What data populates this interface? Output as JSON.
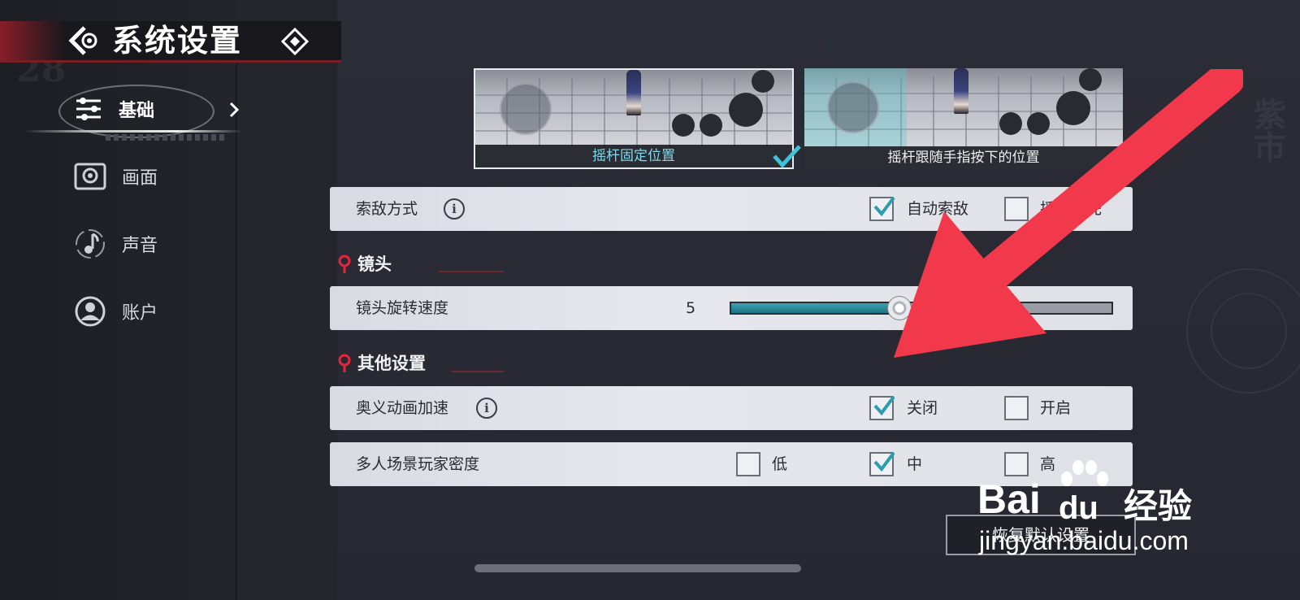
{
  "header": {
    "title": "系统设置"
  },
  "sidebar": {
    "items": [
      {
        "label": "基础",
        "icon": "sliders-icon",
        "active": true
      },
      {
        "label": "画面",
        "icon": "display-icon",
        "active": false
      },
      {
        "label": "声音",
        "icon": "music-note-icon",
        "active": false
      },
      {
        "label": "账户",
        "icon": "user-icon",
        "active": false
      }
    ]
  },
  "joystick": {
    "options": [
      {
        "label": "摇杆固定位置",
        "selected": true
      },
      {
        "label": "摇杆跟随手指按下的位置",
        "selected": false
      }
    ]
  },
  "targeting": {
    "label": "索敌方式",
    "options": [
      {
        "label": "自动索敌",
        "checked": true
      },
      {
        "label": "摇杆优先",
        "checked": false
      }
    ]
  },
  "camera_section": {
    "title": "镜头",
    "rotation_speed": {
      "label": "镜头旋转速度",
      "value": "5",
      "fraction": 0.44
    }
  },
  "other_section": {
    "title": "其他设置",
    "ultimate_anim": {
      "label": "奥义动画加速",
      "options": [
        {
          "label": "关闭",
          "checked": true
        },
        {
          "label": "开启",
          "checked": false
        }
      ]
    },
    "player_density": {
      "label": "多人场景玩家密度",
      "options": [
        {
          "label": "低",
          "checked": false
        },
        {
          "label": "中",
          "checked": true
        },
        {
          "label": "高",
          "checked": false
        }
      ]
    }
  },
  "reset_button": {
    "label": "恢复默认设置"
  },
  "watermark": {
    "brand": "Bai",
    "brand2": "du",
    "suffix": "经验",
    "url": "jingyan.baidu.com"
  },
  "colors": {
    "accent_teal": "#2aa3b5",
    "accent_red": "#e8233a",
    "arrow_red": "#f2394b"
  }
}
